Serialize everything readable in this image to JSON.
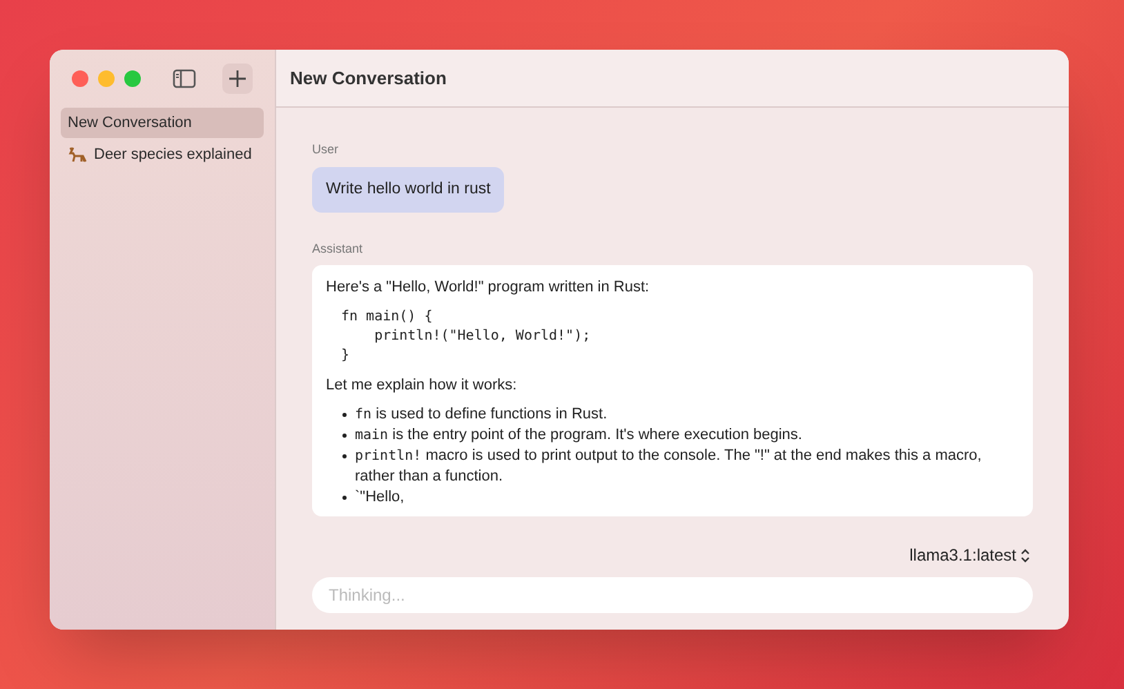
{
  "window": {
    "title": "New Conversation"
  },
  "sidebar": {
    "items": [
      {
        "label": "New Conversation",
        "selected": true,
        "kind": "plain"
      },
      {
        "label": "Deer species explained",
        "selected": false,
        "kind": "with-icon"
      }
    ]
  },
  "messages": [
    {
      "role": "User",
      "kind": "user",
      "text": "Write hello world in rust"
    },
    {
      "role": "Assistant",
      "kind": "assistant",
      "intro": "Here's a \"Hello, World!\" program written in Rust:",
      "code": "fn main() {\n    println!(\"Hello, World!\");\n}",
      "explain": "Let me explain how it works:",
      "bullets": [
        {
          "code": "fn",
          "text": " is used to define functions in Rust."
        },
        {
          "code": "main",
          "text": " is the entry point of the program. It's where execution begins."
        },
        {
          "code": "println!",
          "text": " macro is used to print output to the console. The \"!\" at the end makes this a macro, rather than a function."
        },
        {
          "text": "`\"Hello,"
        }
      ]
    }
  ],
  "model_picker": {
    "value": "llama3.1:latest"
  },
  "input": {
    "placeholder": "Thinking..."
  }
}
